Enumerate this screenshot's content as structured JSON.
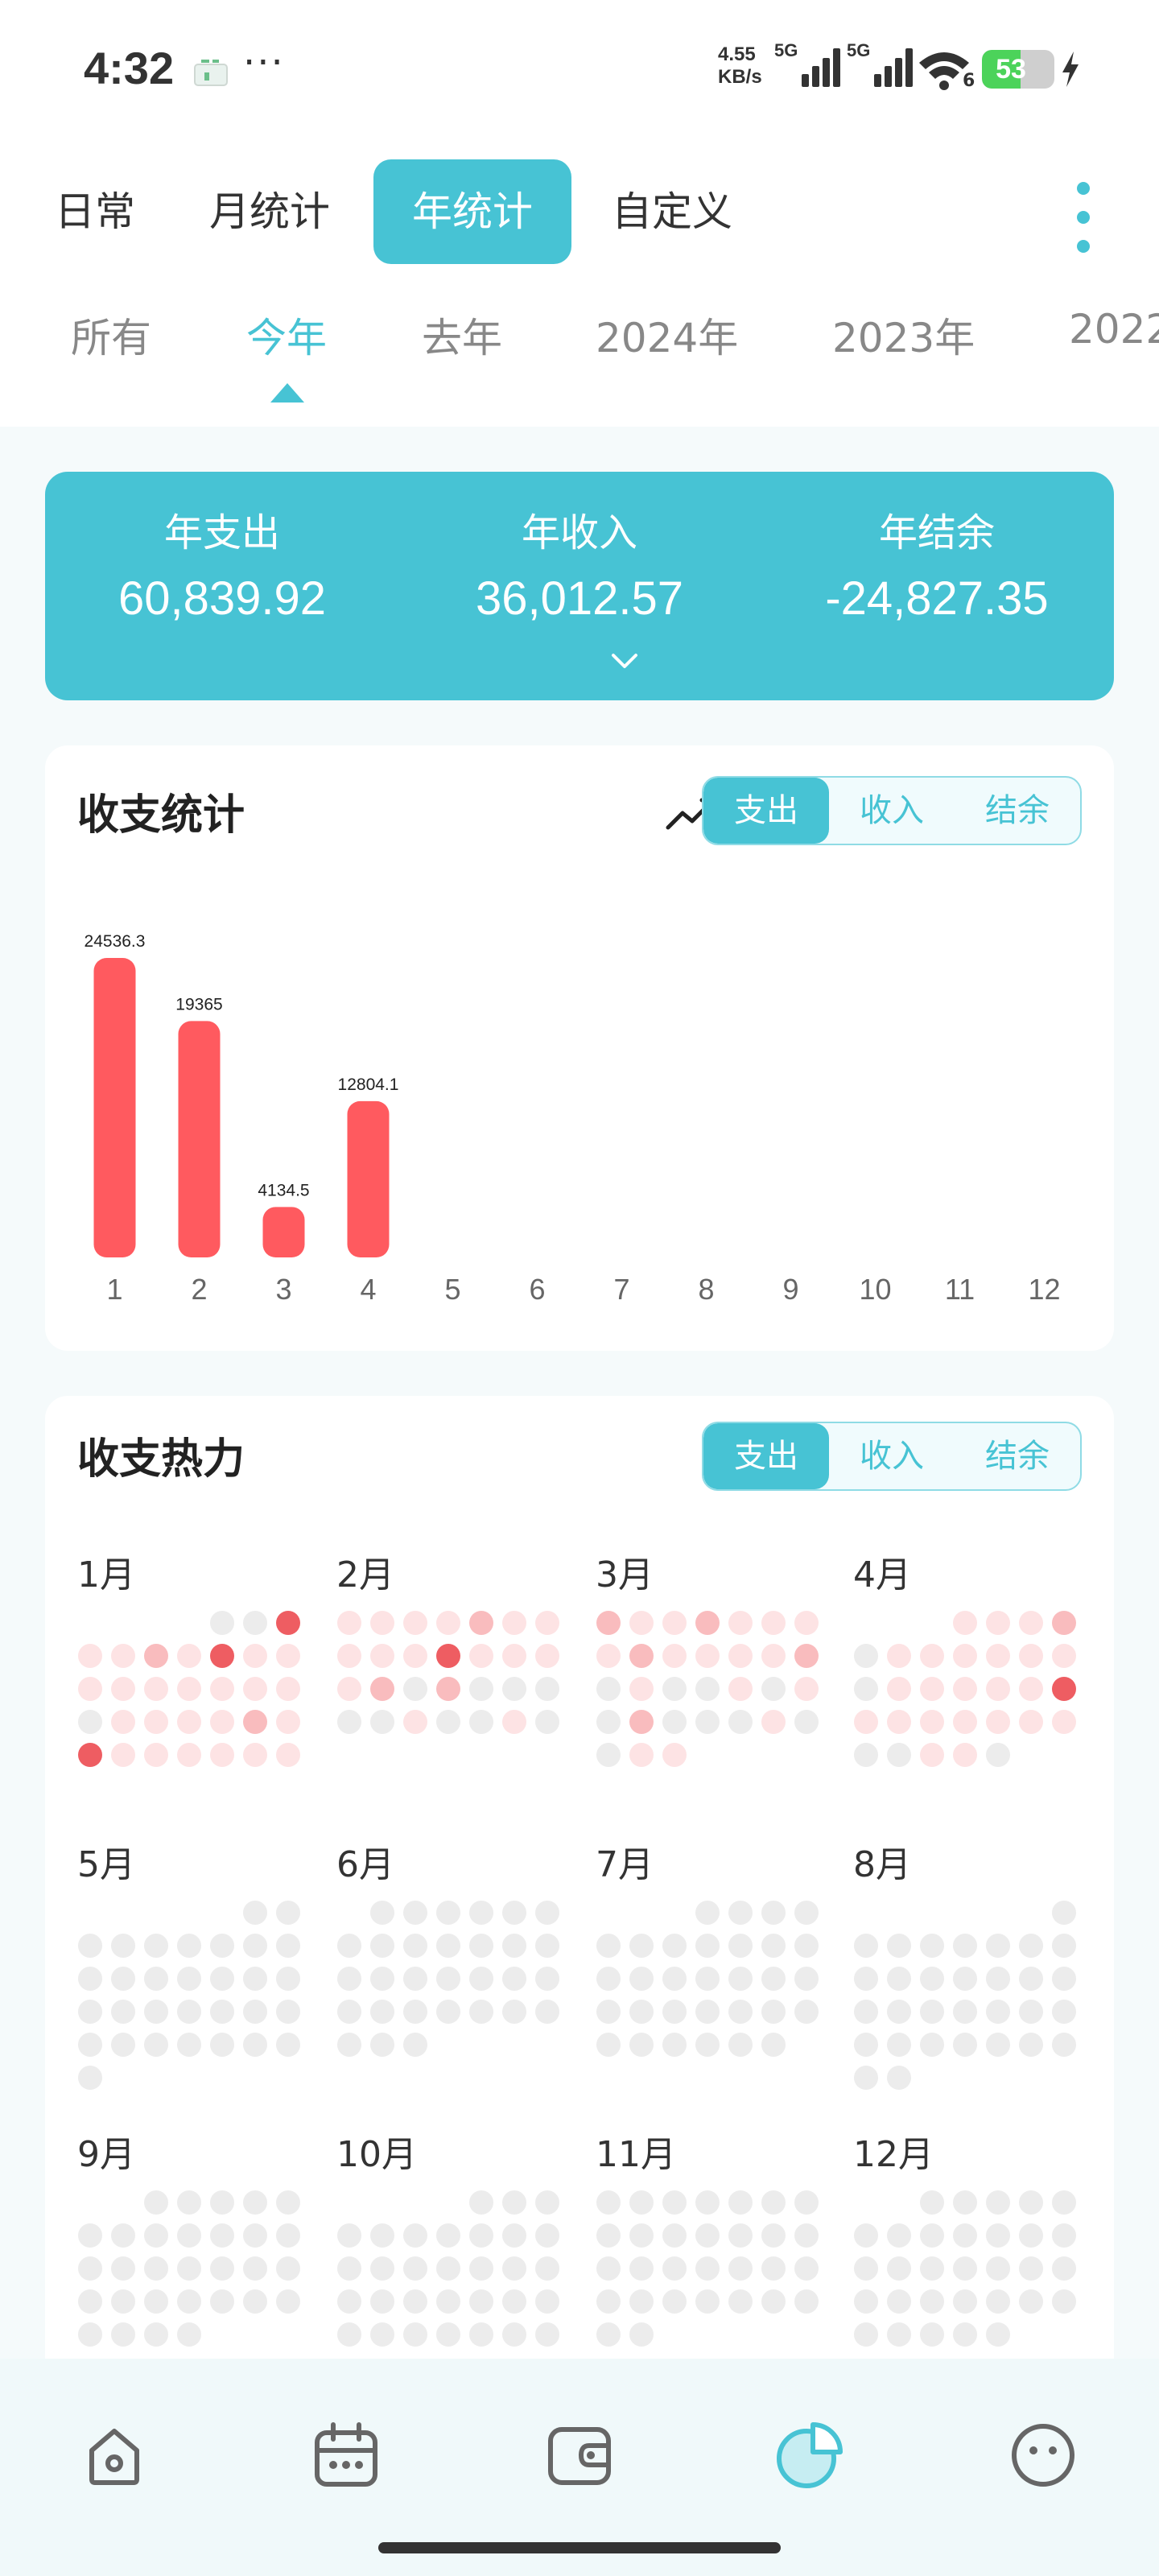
{
  "status": {
    "time": "4:32",
    "dots": "···",
    "net_speed_value": "4.55",
    "net_speed_unit": "KB/s",
    "net_label_1": "5G",
    "net_label_2": "5G",
    "wifi_label": "6",
    "battery": "53",
    "battery_level": 0.53,
    "colors": {
      "battery": "#4cd35a"
    }
  },
  "tabs": {
    "items": [
      {
        "label": "日常"
      },
      {
        "label": "月统计"
      },
      {
        "label": "年统计"
      },
      {
        "label": "自定义"
      }
    ],
    "active_index": 2
  },
  "year_tabs": {
    "items": [
      {
        "label": "所有"
      },
      {
        "label": "今年"
      },
      {
        "label": "去年"
      },
      {
        "label": "2024年"
      },
      {
        "label": "2023年"
      },
      {
        "label": "2022"
      }
    ],
    "active_index": 1
  },
  "summary": {
    "expense_label": "年支出",
    "expense_value": "60,839.92",
    "income_label": "年收入",
    "income_value": "36,012.57",
    "balance_label": "年结余",
    "balance_value": "-24,827.35"
  },
  "stats_card": {
    "title": "收支统计",
    "segments": [
      {
        "label": "支出"
      },
      {
        "label": "收入"
      },
      {
        "label": "结余"
      }
    ],
    "active_segment": 0
  },
  "chart_data": {
    "type": "bar",
    "categories": [
      "1",
      "2",
      "3",
      "4",
      "5",
      "6",
      "7",
      "8",
      "9",
      "10",
      "11",
      "12"
    ],
    "values": [
      24536.3,
      19365,
      4134.5,
      12804.1,
      null,
      null,
      null,
      null,
      null,
      null,
      null,
      null
    ],
    "data_labels": [
      "24536.3",
      "19365",
      "4134.5",
      "12804.1",
      "",
      "",
      "",
      "",
      "",
      "",
      "",
      ""
    ],
    "title": "",
    "xlabel": "",
    "ylabel": "",
    "grid": false,
    "bar_color": "#ff5a5f"
  },
  "heat_card": {
    "title": "收支热力",
    "segments": [
      {
        "label": "支出"
      },
      {
        "label": "收入"
      },
      {
        "label": "结余"
      }
    ],
    "active_segment": 0,
    "colors": {
      "empty": "#ececec",
      "low": "#fde3e4",
      "mid": "#f9bcbe",
      "high": "#ee5d62"
    },
    "months": [
      {
        "label": "1月",
        "offset": 4,
        "days": [
          0,
          0,
          0,
          0,
          0,
          0,
          0,
          0,
          0,
          0,
          0,
          0,
          0,
          0,
          0,
          0,
          0,
          0,
          0,
          0,
          0,
          0,
          0,
          0,
          0,
          0,
          0,
          0,
          0,
          0,
          0
        ],
        "levels": [
          0,
          0,
          3,
          1,
          1,
          2,
          1,
          3,
          1,
          1,
          1,
          1,
          1,
          1,
          1,
          1,
          1,
          0,
          1,
          1,
          1,
          1,
          2,
          1,
          3,
          1,
          1,
          1,
          1,
          1,
          1
        ]
      },
      {
        "label": "2月",
        "offset": 0,
        "levels": [
          1,
          1,
          1,
          1,
          2,
          1,
          1,
          1,
          1,
          1,
          3,
          1,
          1,
          1,
          1,
          2,
          0,
          2,
          0,
          0,
          0,
          0,
          0,
          1,
          0,
          0,
          1,
          0
        ]
      },
      {
        "label": "3月",
        "offset": 0,
        "levels": [
          2,
          1,
          1,
          2,
          1,
          1,
          1,
          1,
          2,
          1,
          1,
          1,
          1,
          2,
          0,
          1,
          0,
          0,
          1,
          0,
          1,
          0,
          2,
          0,
          0,
          0,
          1,
          0,
          0,
          1,
          1
        ]
      },
      {
        "label": "4月",
        "offset": 3,
        "levels": [
          1,
          1,
          1,
          2,
          0,
          1,
          1,
          1,
          1,
          1,
          1,
          0,
          1,
          1,
          1,
          1,
          1,
          3,
          1,
          1,
          1,
          1,
          1,
          1,
          1,
          0,
          0,
          1,
          1,
          0
        ]
      },
      {
        "label": "5月",
        "offset": 5,
        "levels": [
          0,
          0,
          0,
          0,
          0,
          0,
          0,
          0,
          0,
          0,
          0,
          0,
          0,
          0,
          0,
          0,
          0,
          0,
          0,
          0,
          0,
          0,
          0,
          0,
          0,
          0,
          0,
          0,
          0,
          0,
          0
        ]
      },
      {
        "label": "6月",
        "offset": 1,
        "levels": [
          0,
          0,
          0,
          0,
          0,
          0,
          0,
          0,
          0,
          0,
          0,
          0,
          0,
          0,
          0,
          0,
          0,
          0,
          0,
          0,
          0,
          0,
          0,
          0,
          0,
          0,
          0,
          0,
          0,
          0
        ]
      },
      {
        "label": "7月",
        "offset": 3,
        "levels": [
          0,
          0,
          0,
          0,
          0,
          0,
          0,
          0,
          0,
          0,
          0,
          0,
          0,
          0,
          0,
          0,
          0,
          0,
          0,
          0,
          0,
          0,
          0,
          0,
          0,
          0,
          0,
          0,
          0,
          0,
          0
        ]
      },
      {
        "label": "8月",
        "offset": 6,
        "levels": [
          0,
          0,
          0,
          0,
          0,
          0,
          0,
          0,
          0,
          0,
          0,
          0,
          0,
          0,
          0,
          0,
          0,
          0,
          0,
          0,
          0,
          0,
          0,
          0,
          0,
          0,
          0,
          0,
          0,
          0,
          0
        ]
      },
      {
        "label": "9月",
        "offset": 2,
        "levels": [
          0,
          0,
          0,
          0,
          0,
          0,
          0,
          0,
          0,
          0,
          0,
          0,
          0,
          0,
          0,
          0,
          0,
          0,
          0,
          0,
          0,
          0,
          0,
          0,
          0,
          0,
          0,
          0,
          0,
          0
        ]
      },
      {
        "label": "10月",
        "offset": 4,
        "levels": [
          0,
          0,
          0,
          0,
          0,
          0,
          0,
          0,
          0,
          0,
          0,
          0,
          0,
          0,
          0,
          0,
          0,
          0,
          0,
          0,
          0,
          0,
          0,
          0,
          0,
          0,
          0,
          0,
          0,
          0,
          0
        ]
      },
      {
        "label": "11月",
        "offset": 0,
        "levels": [
          0,
          0,
          0,
          0,
          0,
          0,
          0,
          0,
          0,
          0,
          0,
          0,
          0,
          0,
          0,
          0,
          0,
          0,
          0,
          0,
          0,
          0,
          0,
          0,
          0,
          0,
          0,
          0,
          0,
          0
        ]
      },
      {
        "label": "12月",
        "offset": 2,
        "levels": [
          0,
          0,
          0,
          0,
          0,
          0,
          0,
          0,
          0,
          0,
          0,
          0,
          0,
          0,
          0,
          0,
          0,
          0,
          0,
          0,
          0,
          0,
          0,
          0,
          0,
          0,
          0,
          0,
          0,
          0,
          0
        ]
      }
    ]
  },
  "nav": {
    "items": [
      {
        "icon": "home-icon"
      },
      {
        "icon": "calendar-icon"
      },
      {
        "icon": "wallet-icon"
      },
      {
        "icon": "pie-chart-icon"
      },
      {
        "icon": "profile-face-icon"
      }
    ],
    "active_index": 3,
    "colors": {
      "active": "#47c3d4",
      "inactive": "#666666"
    }
  },
  "colors": {
    "accent": "#47c3d4",
    "expense": "#ff5a5f"
  }
}
